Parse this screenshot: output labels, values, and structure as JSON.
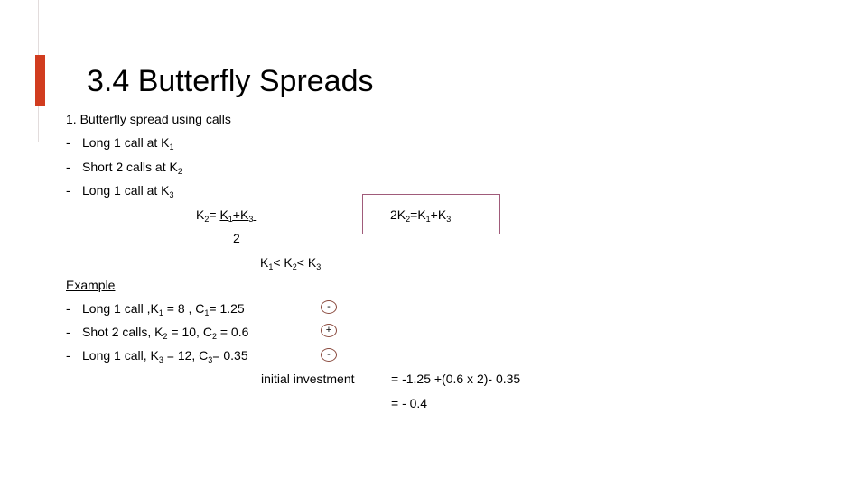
{
  "slide": {
    "title": "3.4 Butterfly Spreads",
    "accent_color": "#d13c1f",
    "heading": "1. Butterfly spread using calls",
    "bullets": [
      {
        "dash": "-",
        "text": "Long 1 call at K",
        "sub": "1"
      },
      {
        "dash": "-",
        "text": "Short 2 calls at K",
        "sub": "2"
      },
      {
        "dash": "-",
        "text": "Long 1 call at K",
        "sub": "3"
      }
    ],
    "formula": {
      "lhs_k": "K",
      "lhs_sub": "2",
      "eq": "= ",
      "num_k1": "K",
      "num_sub1": "1",
      "plus": "+",
      "num_k3": "K",
      "num_sub3": "3",
      "denominator": "2"
    },
    "boxed_formula": {
      "pre": "2K",
      "sub2": "2",
      "eq": "=K",
      "sub1": "1",
      "plus": "+K",
      "sub3": "3",
      "border_color": "#a05b7a"
    },
    "inequality": {
      "k1": "K",
      "s1": "1",
      "lt1": "< K",
      "s2": "2",
      "lt2": "< K",
      "s3": "3"
    },
    "example": {
      "label": "Example",
      "items": [
        {
          "dash": "-",
          "a": "Long 1 call ,K",
          "s1": "1",
          "b": " = 8 , C",
          "s2": "1",
          "c": "= 1.25",
          "sign": "-"
        },
        {
          "dash": "-",
          "a": "Shot 2 calls, K",
          "s1": "2",
          "b": " = 10, C",
          "s2": "2",
          "c": " = 0.6",
          "sign": "+"
        },
        {
          "dash": "-",
          "a": "Long 1 call, K",
          "s1": "3",
          "b": " = 12, C",
          "s2": "3",
          "c": "= 0.35",
          "sign": "-"
        }
      ],
      "investment_label": "initial investment",
      "calc_line1": "= -1.25 +(0.6 x 2)- 0.35",
      "calc_line2": "= - 0.4"
    }
  }
}
